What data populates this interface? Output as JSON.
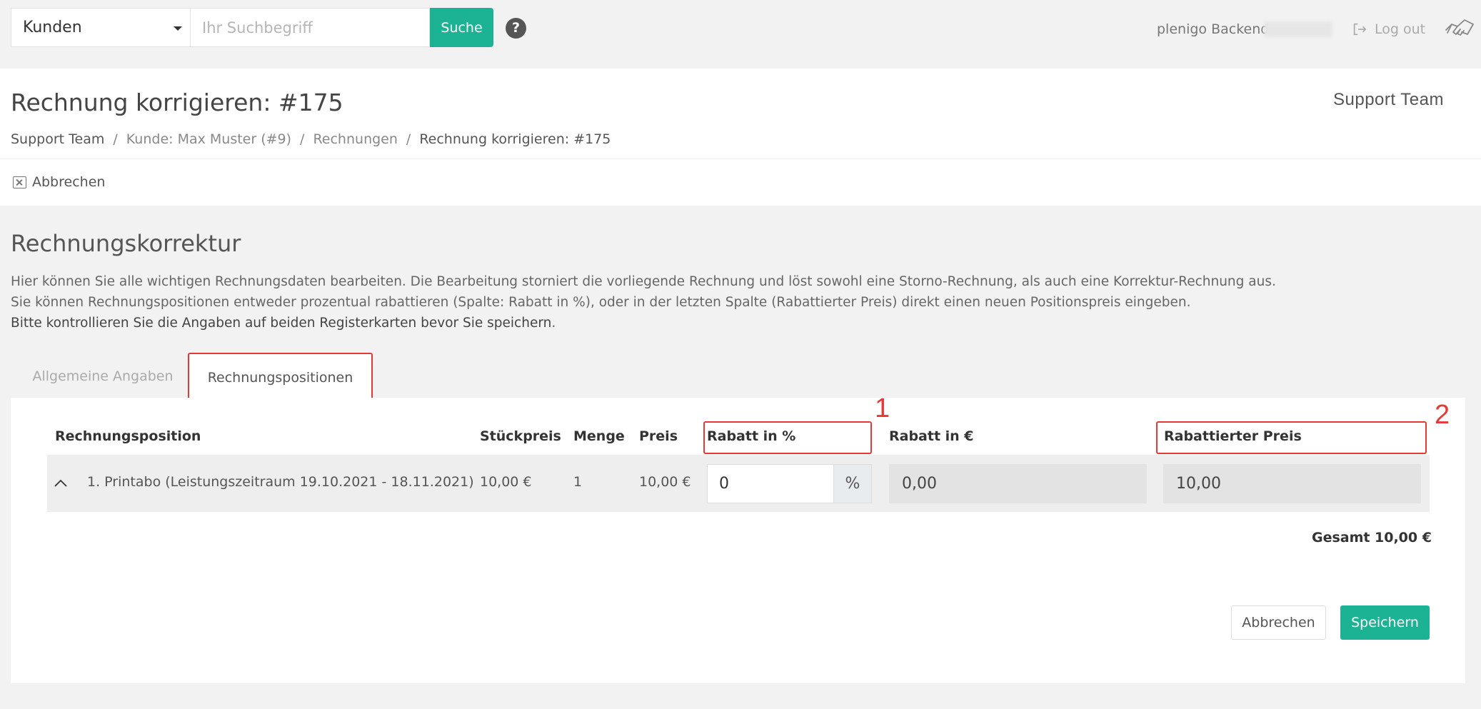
{
  "topbar": {
    "select_value": "Kunden",
    "search_placeholder": "Ihr Suchbegriff",
    "search_button": "Suche",
    "help_icon": "question-circle-icon",
    "backend_label": "plenigo Backend",
    "logout_label": "Log out",
    "logout_icon": "sign-out-icon",
    "logo_icon": "handshake-icon"
  },
  "header": {
    "title": "Rechnung korrigieren: #175",
    "team": "Support Team",
    "breadcrumb": [
      "Support Team",
      "Kunde: Max Muster (#9)",
      "Rechnungen",
      "Rechnung korrigieren: #175"
    ],
    "cancel_label": "Abbrechen",
    "cancel_icon": "close-square-icon"
  },
  "section": {
    "title": "Rechnungskorrektur",
    "intro_line1": "Hier können Sie alle wichtigen Rechnungsdaten bearbeiten. Die Bearbeitung storniert die vorliegende Rechnung und löst sowohl eine Storno-Rechnung, als auch eine Korrektur-Rechnung aus.",
    "intro_line2": "Sie können Rechnungspositionen entweder prozentual rabattieren (Spalte: Rabatt in %), oder in der letzten Spalte (Rabattierter Preis) direkt einen neuen Positionspreis eingeben.",
    "intro_line3_bold": "Bitte kontrollieren Sie die Angaben auf beiden Registerkarten bevor Sie speichern",
    "intro_line3_end": "."
  },
  "tabs": [
    {
      "label": "Allgemeine Angaben",
      "active": false
    },
    {
      "label": "Rechnungspositionen",
      "active": true
    }
  ],
  "table": {
    "columns": [
      "Rechnungsposition",
      "Stückpreis",
      "Menge",
      "Preis",
      "Rabatt in %",
      "Rabatt in €",
      "Rabattierter Preis"
    ],
    "markers": [
      "1",
      "2"
    ],
    "row": {
      "position": "1. Printabo (Leistungszeitraum 19.10.2021 - 18.11.2021)",
      "unit_price": "10,00 €",
      "quantity": "1",
      "price": "10,00 €",
      "discount_percent": "0",
      "percent_symbol": "%",
      "discount_eur": "0,00",
      "discounted_price": "10,00"
    },
    "total_label": "Gesamt",
    "total_value": "10,00 €"
  },
  "footer": {
    "cancel": "Abbrechen",
    "save": "Speichern"
  },
  "colors": {
    "accent": "#1bb394",
    "highlight": "#e53935"
  }
}
